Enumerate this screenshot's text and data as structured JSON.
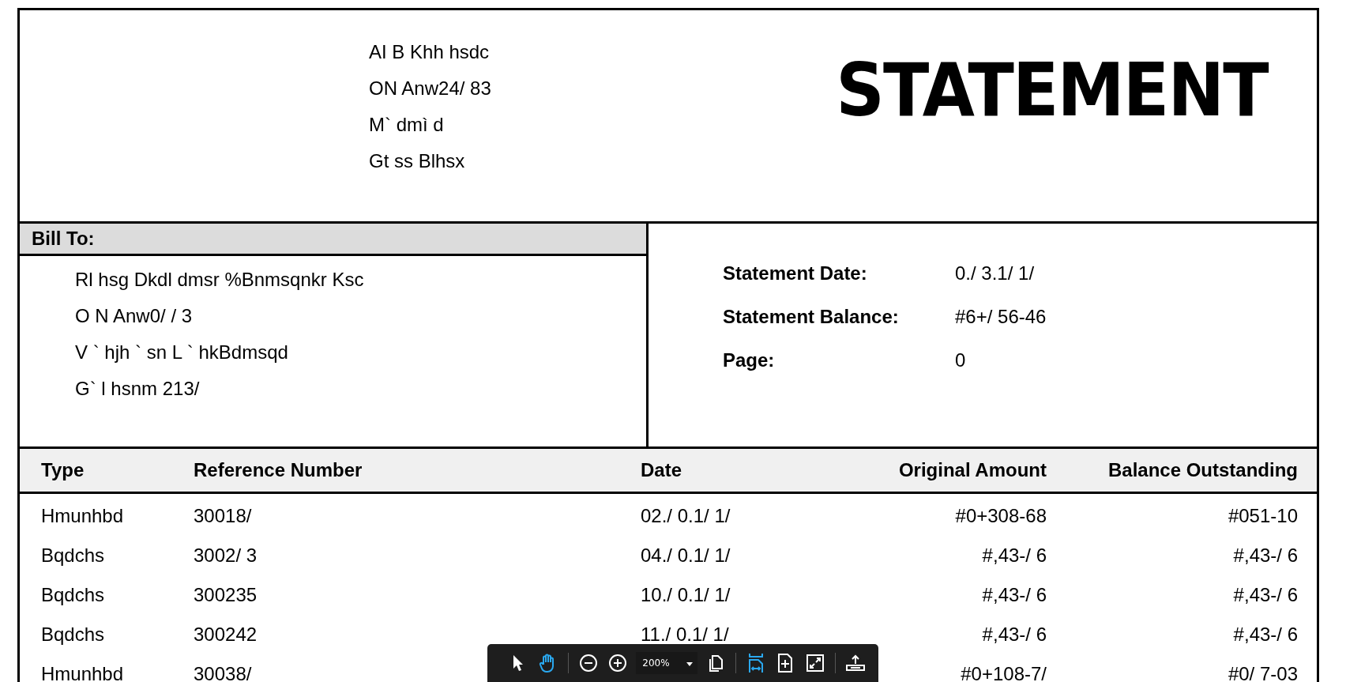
{
  "header": {
    "address": [
      "AI B Khh hsdc",
      "ON Anw24/ 83",
      "M` dmì d",
      "Gt ss Blhsx"
    ],
    "title": "STATEMENT"
  },
  "bill_to": {
    "heading": "Bill To:",
    "lines": [
      "Rl hsg Dkdl dmsr %Bnmsqnkr Ksc",
      "O N Anw0/ / 3",
      "V ` hjh ` sn L ` hkBdmsqd",
      "G` l hsnm 213/"
    ]
  },
  "statement_info": [
    {
      "label": "Statement Date:",
      "value": "0./ 3.1/ 1/"
    },
    {
      "label": "Statement Balance:",
      "value": "#6+/ 56-46"
    },
    {
      "label": "Page:",
      "value": "0"
    }
  ],
  "table": {
    "columns": [
      "Type",
      "Reference Number",
      "Date",
      "Original Amount",
      "Balance Outstanding"
    ],
    "rows": [
      {
        "type": "Hmunhbd",
        "reference": "30018/",
        "date": "02./ 0.1/ 1/",
        "original_amount": "#0+308-68",
        "balance": "#051-10"
      },
      {
        "type": "Bqdchs",
        "reference": "3002/ 3",
        "date": "04./ 0.1/ 1/",
        "original_amount": "#,43-/ 6",
        "balance": "#,43-/ 6"
      },
      {
        "type": "Bqdchs",
        "reference": "300235",
        "date": "10./ 0.1/ 1/",
        "original_amount": "#,43-/ 6",
        "balance": "#,43-/ 6"
      },
      {
        "type": "Bqdchs",
        "reference": "300242",
        "date": "11./ 0.1/ 1/",
        "original_amount": "#,43-/ 6",
        "balance": "#,43-/ 6"
      },
      {
        "type": "Hmunhbd",
        "reference": "30038/",
        "original_amount": "#0+108-7/",
        "balance": "#0/ 7-03"
      }
    ]
  },
  "toolbar": {
    "tools": [
      {
        "kind": "pointer",
        "selected": false
      },
      {
        "kind": "hand",
        "selected": true
      },
      {
        "kind": "separator"
      },
      {
        "kind": "zoom-out",
        "selected": false
      },
      {
        "kind": "zoom-in",
        "selected": false
      },
      {
        "kind": "zoom",
        "value": "200%"
      },
      {
        "kind": "pages",
        "selected": false
      },
      {
        "kind": "separator"
      },
      {
        "kind": "fit-width",
        "selected": true
      },
      {
        "kind": "fit-page",
        "selected": false
      },
      {
        "kind": "fullscreen",
        "selected": false
      },
      {
        "kind": "separator"
      },
      {
        "kind": "share",
        "selected": false
      }
    ]
  }
}
